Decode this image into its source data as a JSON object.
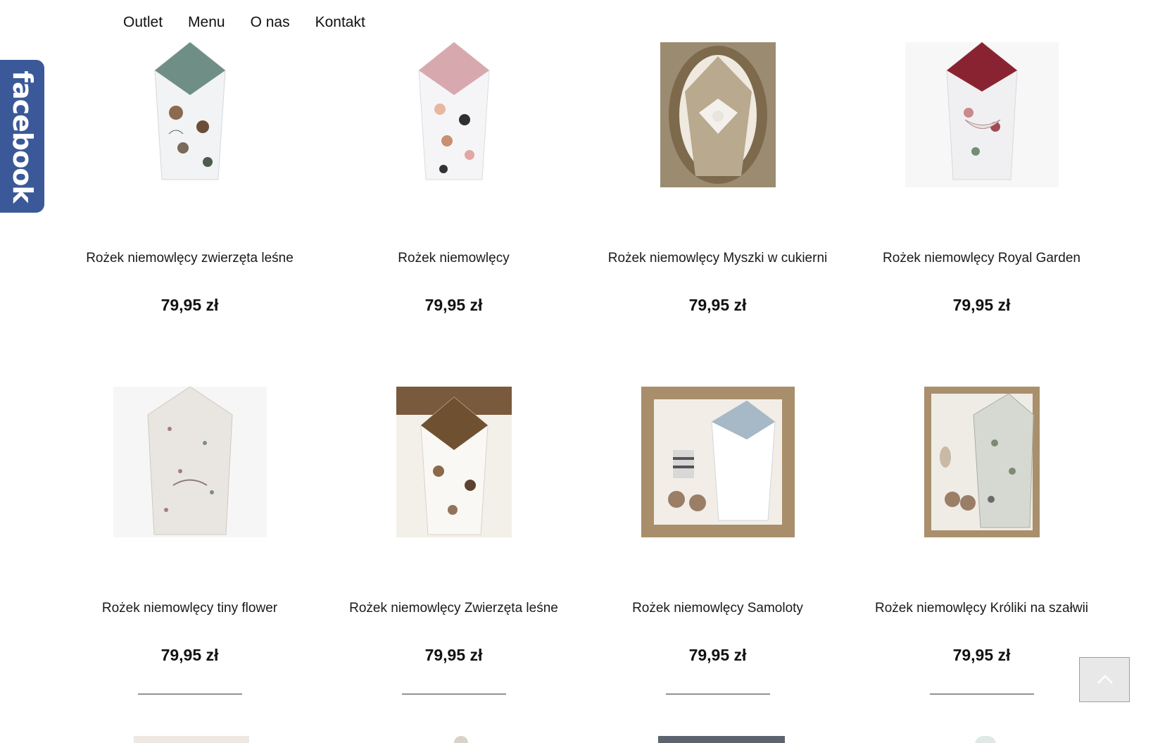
{
  "nav": {
    "items": [
      {
        "label": "Outlet"
      },
      {
        "label": "Menu"
      },
      {
        "label": "O nas"
      },
      {
        "label": "Kontakt"
      }
    ]
  },
  "facebook": {
    "label": "facebook"
  },
  "products": [
    {
      "title": "Rożek niemowlęcy zwierzęta leśne",
      "price": "79,95 zł",
      "image_icon": "swaddle-teal-forest-animals"
    },
    {
      "title": "Rożek niemowlęcy",
      "price": "79,95 zł",
      "image_icon": "swaddle-pink-pandas"
    },
    {
      "title": "Rożek niemowlęcy Myszki w cukierni",
      "price": "79,95 zł",
      "image_icon": "swaddle-beige-in-basket"
    },
    {
      "title": "Rożek niemowlęcy Royal Garden",
      "price": "79,95 zł",
      "image_icon": "swaddle-burgundy-floral"
    },
    {
      "title": "Rożek niemowlęcy tiny flower",
      "price": "79,95 zł",
      "image_icon": "swaddle-tiny-flower"
    },
    {
      "title": "Rożek niemowlęcy Zwierzęta leśne",
      "price": "79,95 zł",
      "image_icon": "swaddle-brown-forest-animals"
    },
    {
      "title": "Rożek niemowlęcy Samoloty",
      "price": "79,95 zł",
      "image_icon": "swaddle-blue-airplanes"
    },
    {
      "title": "Rożek niemowlęcy Króliki na szałwii",
      "price": "79,95 zł",
      "image_icon": "swaddle-sage-rabbits"
    }
  ],
  "scroll_top": {
    "icon": "chevron-up-icon"
  },
  "colors": {
    "facebook_blue": "#3b5998"
  }
}
